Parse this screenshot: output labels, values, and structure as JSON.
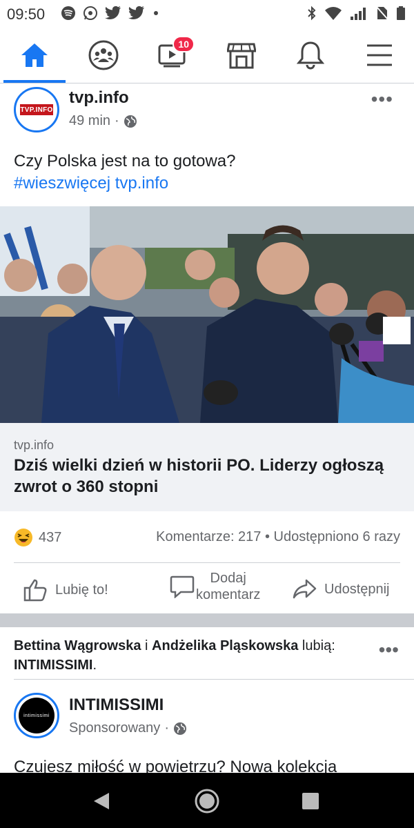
{
  "status_bar": {
    "time": "09:50"
  },
  "nav": {
    "watch_badge": "10"
  },
  "post": {
    "page_name": "tvp.info",
    "time": "49 min",
    "text_line1": "Czy Polska jest na to gotowa?",
    "hashtag": "#wieszwięcej",
    "link_text": "tvp.info",
    "logo_text": "TVP.INFO",
    "link_domain": "tvp.info",
    "link_title": "Dziś wielki dzień w historii PO. Liderzy ogłoszą zwrot o 360 stopni",
    "reaction_count": "437",
    "comments_shares": "Komentarze: 217 • Udostępniono 6 razy",
    "like_label": "Lubię to!",
    "comment_label_1": "Dodaj",
    "comment_label_2": "komentarz",
    "share_label": "Udostępnij"
  },
  "social_context": {
    "person1": "Bettina Wągrowska",
    "conj": " i ",
    "person2": "Andżelika Pląskowska",
    "verb": " lubią:",
    "page": "INTIMISSIMI",
    "dot": "."
  },
  "ad": {
    "name": "INTIMISSIMI",
    "logo_text": "intimissimi",
    "sponsored": "Sponsorowany",
    "text": "Czujesz miłość w powietrzu? Nowa kolekcja"
  },
  "colors": {
    "accent": "#1877f2",
    "badge": "#f02849"
  }
}
